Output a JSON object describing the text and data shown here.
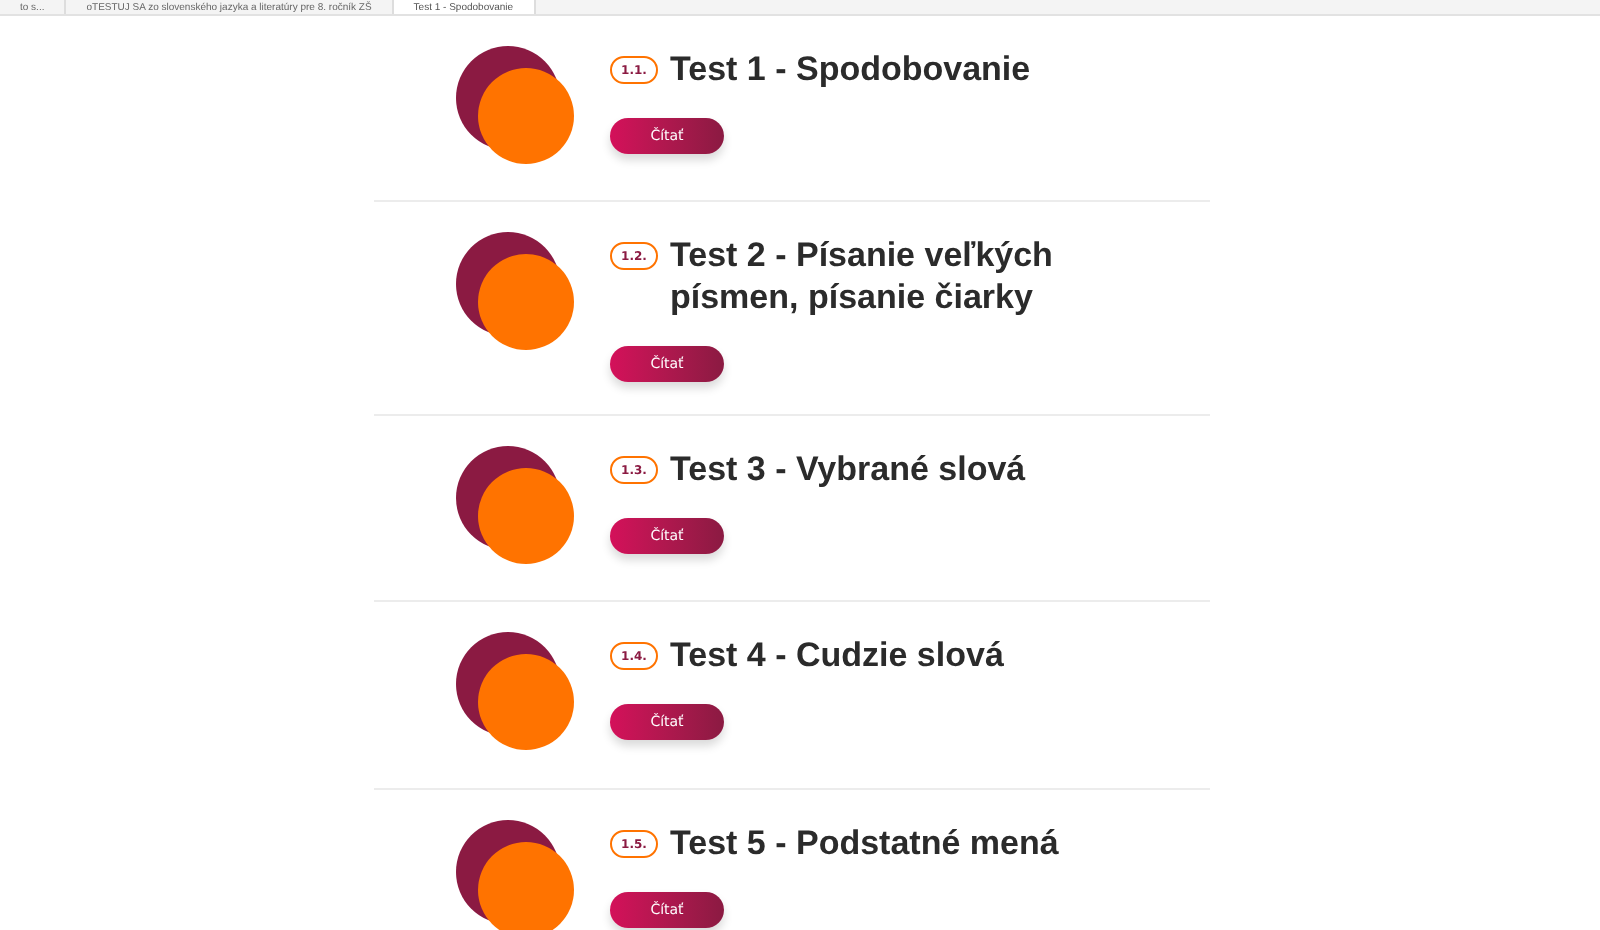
{
  "breadcrumbs": [
    {
      "label": "to s...",
      "selected": false
    },
    {
      "label": "oTESTUJ SA zo slovenského jazyka a literatúry pre 8. ročník ZŠ",
      "selected": false
    },
    {
      "label": "Test 1 - Spodobovanie",
      "selected": true
    }
  ],
  "tests": [
    {
      "number": "1.1.",
      "title": "Test 1 - Spodobovanie",
      "button": "Čítať"
    },
    {
      "number": "1.2.",
      "title": "Test 2 - Písanie veľkých písmen, písanie čiarky",
      "button": "Čítať"
    },
    {
      "number": "1.3.",
      "title": "Test 3 - Vybrané slová",
      "button": "Čítať"
    },
    {
      "number": "1.4.",
      "title": "Test 4 - Cudzie slová",
      "button": "Čítať"
    },
    {
      "number": "1.5.",
      "title": "Test 5 - Podstatné mená",
      "button": "Čítať"
    }
  ]
}
